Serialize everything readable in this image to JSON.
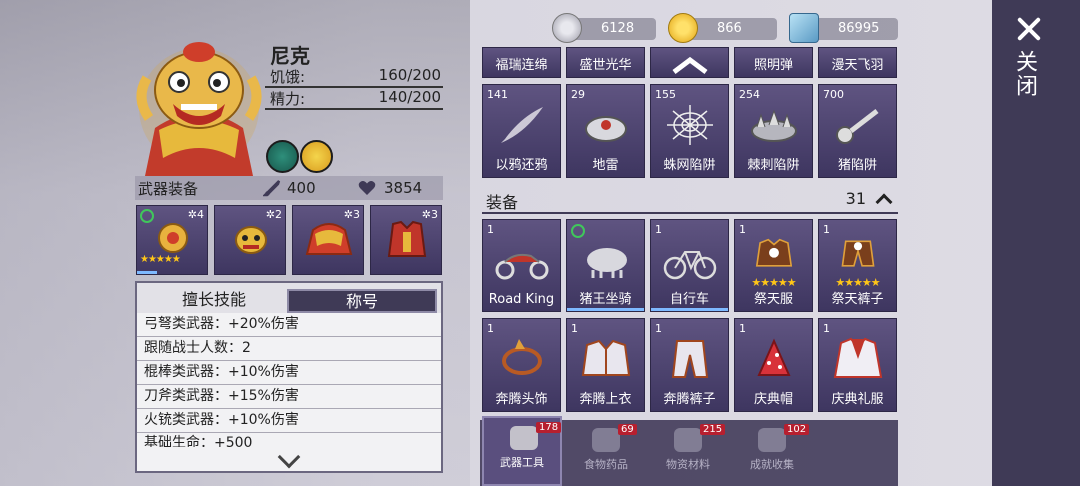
{
  "close": {
    "label": "关闭"
  },
  "character": {
    "name": "尼克",
    "stats": [
      {
        "label": "饥饿:",
        "value": "160/200"
      },
      {
        "label": "精力:",
        "value": "140/200"
      }
    ]
  },
  "weapons": {
    "title": "武器装备",
    "attack": "400",
    "health": "3854",
    "slots": [
      {
        "level": "4",
        "stars": "★★★★★"
      },
      {
        "level": "2",
        "stars": ""
      },
      {
        "level": "3",
        "stars": ""
      },
      {
        "level": "3",
        "stars": ""
      }
    ]
  },
  "skills": {
    "tabs": [
      "擅长技能",
      "称号"
    ],
    "rows": [
      "弓弩类武器：+20%伤害",
      "跟随战士人数：2",
      "棍棒类武器：+10%伤害",
      "刀斧类武器：+15%伤害",
      "火铳类武器：+10%伤害",
      "基础生命：+500"
    ]
  },
  "currency": [
    "6128",
    "866",
    "86995"
  ],
  "top_row": [
    "福瑞连绵",
    "盛世光华",
    "",
    "照明弹",
    "漫天飞羽"
  ],
  "traps": [
    {
      "count": "141",
      "label": "以鸦还鸦"
    },
    {
      "count": "29",
      "label": "地雷"
    },
    {
      "count": "155",
      "label": "蛛网陷阱"
    },
    {
      "count": "254",
      "label": "棘刺陷阱"
    },
    {
      "count": "700",
      "label": "猪陷阱"
    }
  ],
  "equipment": {
    "title": "装备",
    "count": "31",
    "row1": [
      {
        "count": "1",
        "label": "Road King",
        "stars": ""
      },
      {
        "count": "",
        "label": "猪王坐骑",
        "stars": ""
      },
      {
        "count": "1",
        "label": "自行车",
        "stars": ""
      },
      {
        "count": "1",
        "label": "祭天服",
        "stars": "★★★★★"
      },
      {
        "count": "1",
        "label": "祭天裤子",
        "stars": "★★★★★"
      }
    ],
    "row2": [
      {
        "count": "1",
        "label": "奔腾头饰"
      },
      {
        "count": "1",
        "label": "奔腾上衣"
      },
      {
        "count": "1",
        "label": "奔腾裤子"
      },
      {
        "count": "1",
        "label": "庆典帽"
      },
      {
        "count": "1",
        "label": "庆典礼服"
      }
    ]
  },
  "bottom_tabs": [
    {
      "label": "武器工具",
      "badge": "178"
    },
    {
      "label": "食物药品",
      "badge": "69"
    },
    {
      "label": "物资材料",
      "badge": "215"
    },
    {
      "label": "成就收集",
      "badge": "102"
    }
  ]
}
